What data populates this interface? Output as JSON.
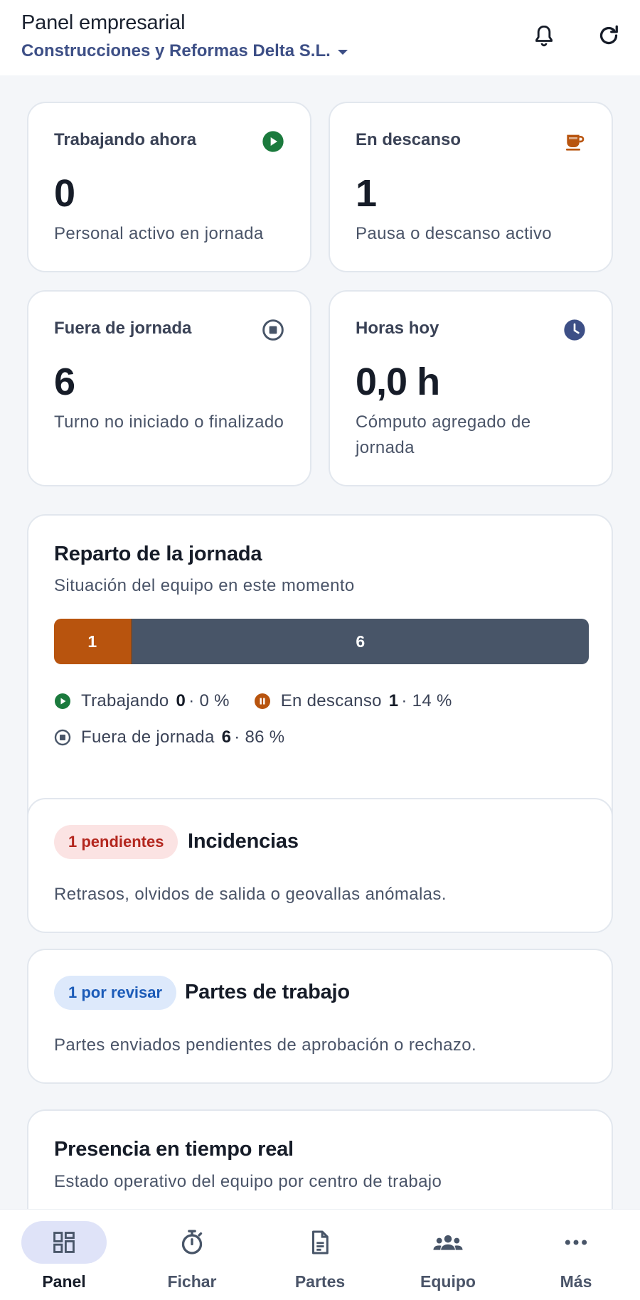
{
  "header": {
    "title": "Panel empresarial",
    "company": "Construcciones y Reformas Delta S.L."
  },
  "stats": [
    {
      "label": "Trabajando ahora",
      "value": "0",
      "desc": "Personal activo en jornada",
      "icon": "play-circle-icon",
      "color": "#1b7a3d"
    },
    {
      "label": "En descanso",
      "value": "1",
      "desc": "Pausa o descanso activo",
      "icon": "coffee-cup-icon",
      "color": "#b8540e"
    },
    {
      "label": "Fuera de jornada",
      "value": "6",
      "desc": "Turno no iniciado o finalizado",
      "icon": "stop-circle-icon",
      "color": "#485568"
    },
    {
      "label": "Horas hoy",
      "value": "0,0 h",
      "desc": "Cómputo agregado de jornada",
      "icon": "clock-icon",
      "color": "#3d4f86"
    }
  ],
  "distribution": {
    "title": "Reparto de la jornada",
    "subtitle": "Situación del equipo en este momento",
    "bar": [
      {
        "label": "1",
        "fraction": 0.143,
        "color": "#b8540e"
      },
      {
        "label": "6",
        "fraction": 0.857,
        "color": "#485568"
      }
    ],
    "legend": [
      {
        "label": "Trabajando",
        "count": "0",
        "pct": "· 0 %",
        "icon": "play-circle-icon",
        "color": "#1b7a3d"
      },
      {
        "label": "En descanso",
        "count": "1",
        "pct": "· 14 %",
        "icon": "pause-circle-icon",
        "color": "#b8540e"
      },
      {
        "label": "Fuera de jornada",
        "count": "6",
        "pct": "· 86 %",
        "icon": "stop-circle-icon",
        "color": "#485568"
      }
    ]
  },
  "incidents": {
    "badge": "1 pendientes",
    "title": "Incidencias",
    "desc": "Retrasos, olvidos de salida o geovallas anómalas."
  },
  "work_reports": {
    "badge": "1 por revisar",
    "title": "Partes de trabajo",
    "desc": "Partes enviados pendientes de aprobación o rechazo."
  },
  "presence": {
    "title": "Presencia en tiempo real",
    "subtitle": "Estado operativo del equipo por centro de trabajo"
  },
  "nav": {
    "items": [
      {
        "label": "Panel",
        "icon": "dashboard-icon",
        "active": true
      },
      {
        "label": "Fichar",
        "icon": "stopwatch-icon",
        "active": false
      },
      {
        "label": "Partes",
        "icon": "document-icon",
        "active": false
      },
      {
        "label": "Equipo",
        "icon": "group-icon",
        "active": false
      },
      {
        "label": "Más",
        "icon": "more-horizontal-icon",
        "active": false
      }
    ]
  }
}
